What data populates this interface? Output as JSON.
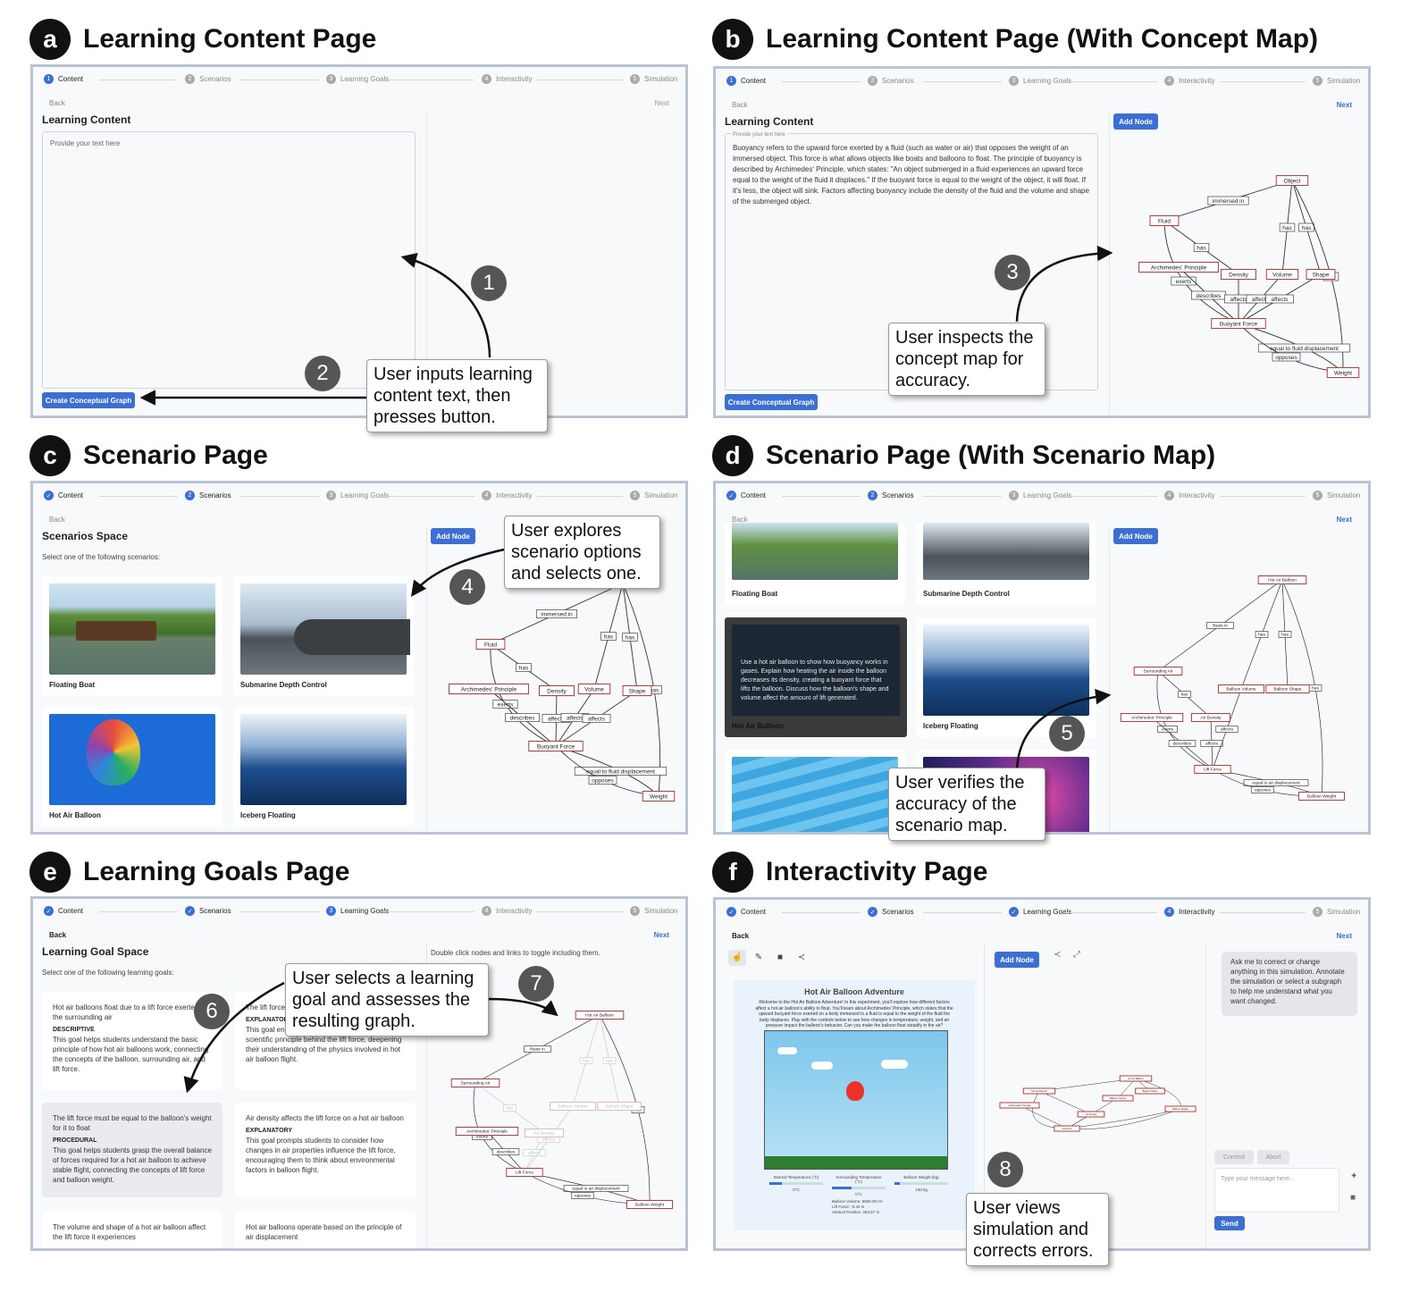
{
  "panels": {
    "a": {
      "letter": "a",
      "title": "Learning Content Page"
    },
    "b": {
      "letter": "b",
      "title": "Learning Content Page (With Concept Map)"
    },
    "c": {
      "letter": "c",
      "title": "Scenario Page"
    },
    "d": {
      "letter": "d",
      "title": "Scenario Page (With Scenario Map)"
    },
    "e": {
      "letter": "e",
      "title": "Learning Goals Page"
    },
    "f": {
      "letter": "f",
      "title": "Interactivity Page"
    }
  },
  "steps": [
    "Content",
    "Scenarios",
    "Learning Goals",
    "Interactivity",
    "Simulation"
  ],
  "step_numbers": [
    "1",
    "2",
    "3",
    "4",
    "5"
  ],
  "nav": {
    "back": "Back",
    "next": "Next"
  },
  "content": {
    "heading": "Learning Content",
    "placeholder": "Provide your text here",
    "create_btn": "Create Conceptual Graph",
    "add_node": "Add Node",
    "text": "Buoyancy refers to the upward force exerted by a fluid (such as water or air) that opposes the weight of an immersed object. This force is what allows objects like boats and balloons to float. The principle of buoyancy is described by Archimedes' Principle, which states: \"An object submerged in a fluid experiences an upward force equal to the weight of the fluid it displaces.\" If the buoyant force is equal to the weight of the object, it will float. If it's less, the object will sink. Factors affecting buoyancy include the density of the fluid and the volume and shape of the submerged object."
  },
  "scenarios": {
    "heading": "Scenarios Space",
    "prompt": "Select one of the following scenarios:",
    "items": [
      "Floating Boat",
      "Submarine Depth Control",
      "Hot Air Balloon",
      "Iceberg Floating"
    ],
    "hover_text": "Use a hot air balloon to show how buoyancy works in gases. Explain how heating the air inside the balloon decreases its density, creating a buoyant force that lifts the balloon. Discuss how the balloon's shape and volume affect the amount of lift generated."
  },
  "concept_map": {
    "nodes": [
      "Object",
      "Fluid",
      "Archimedes' Principle",
      "Density",
      "Volume",
      "Shape",
      "Buoyant Force",
      "Weight"
    ],
    "edges": [
      "immersed in",
      "has",
      "has",
      "has",
      "has",
      "exerts",
      "describes",
      "affects",
      "affects",
      "affects",
      "equal to fluid displacement",
      "opposes"
    ]
  },
  "scenario_map": {
    "nodes": [
      "Hot Air Balloon",
      "Surrounding Air",
      "Archimedes' Principle",
      "Air Density",
      "Balloon Volume",
      "Balloon Shape",
      "Lift Force",
      "Balloon Weight"
    ],
    "edges": [
      "floats in",
      "has",
      "has",
      "has",
      "has",
      "exerts",
      "describes",
      "affects",
      "affects",
      "equal to air displacement",
      "opposes"
    ]
  },
  "goals": {
    "heading": "Learning Goal Space",
    "prompt": "Select one of the following learning goals:",
    "hint": "Double click nodes and links to toggle including them.",
    "items": [
      {
        "title": "Hot air balloons float due to a lift force exerted by the surrounding air",
        "kind": "DESCRIPTIVE",
        "desc": "This goal helps students understand the basic principle of how hot air balloons work, connecting the concepts of the balloon, surrounding air, and lift force."
      },
      {
        "title": "The lift force ... by Archime...",
        "kind": "EXPLANATORY",
        "desc": "This goal encourages students to explore the scientific principle behind the lift force, deepening their understanding of the physics involved in hot air balloon flight."
      },
      {
        "title": "The lift force must be equal to the balloon's weight for it to float",
        "kind": "PROCEDURAL",
        "desc": "This goal helps students grasp the overall balance of forces required for a hot air balloon to achieve stable flight, connecting the concepts of lift force and balloon weight."
      },
      {
        "title": "Air density affects the lift force on a hot air balloon",
        "kind": "EXPLANATORY",
        "desc": "This goal prompts students to consider how changes in air properties influence the lift force, encouraging them to think about environmental factors in balloon flight."
      },
      {
        "title": "The volume and shape of a hot air balloon affect the lift force it experiences",
        "kind": "",
        "desc": ""
      },
      {
        "title": "Hot air balloons operate based on the principle of air displacement",
        "kind": "",
        "desc": ""
      }
    ]
  },
  "interactivity": {
    "sim_title": "Hot Air Balloon Adventure",
    "sim_intro": "Welcome to the Hot Air Balloon Adventure! In this experiment, you'll explore how different factors affect a hot air balloon's ability to float. You'll learn about Archimedes' Principle, which states that the upward buoyant force exerted on a body immersed in a fluid is equal to the weight of the fluid the body displaces. Play with the controls below to see how changes in temperature, weight, and air pressure impact the balloon's behavior. Can you make the balloon float steadily in the air?",
    "sliders": [
      {
        "label": "Internal Temperature (°C)",
        "value": "0°C"
      },
      {
        "label": "Surrounding Temperature (°C)",
        "value": "0°C"
      },
      {
        "label": "Balloon Weight (kg)",
        "value": "100 kg"
      }
    ],
    "readouts": [
      "Balloon Volume: 5500.00 m³",
      "Lift Force: -0.42 N",
      "Vertical Position: 284.57 m"
    ],
    "chat_message": "Ask me to correct or change anything in this simulation. Annotate the simulation or select a subgraph to help me understand what you want changed.",
    "commit": "Commit",
    "abort": "Abort",
    "input_placeholder": "Type your message here...",
    "send": "Send"
  },
  "callouts": {
    "n1": "1",
    "n2": "2",
    "n3": "3",
    "n4": "4",
    "n5": "5",
    "n6": "6",
    "n7": "7",
    "n8": "8",
    "t12": "User inputs learning\ncontent text, then\npresses button.",
    "t3": "User inspects the\nconcept map for\naccuracy.",
    "t4": "User explores\nscenario options\nand selects one.",
    "t5": "User verifies the\naccuracy of the\nscenario map.",
    "t67": "User selects a learning\ngoal and assesses the\nresulting graph.",
    "t8": "User views\nsimulation and\ncorrects errors."
  }
}
